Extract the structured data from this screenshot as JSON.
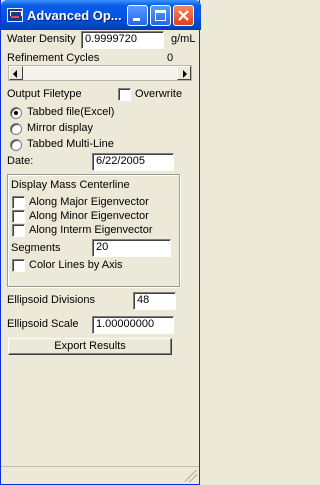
{
  "window": {
    "title": "Advanced Op...",
    "icons": {
      "app": "app-icon",
      "minimize": "minimize-icon",
      "maximize": "maximize-icon",
      "close": "close-icon"
    },
    "colors": {
      "titlebar": "#0057e5",
      "close": "#d8431a",
      "face": "#ece9d8"
    }
  },
  "water_density": {
    "label": "Water Density",
    "value": "0.9999720",
    "unit": "g/mL"
  },
  "refinement": {
    "label": "Refinement Cycles",
    "value": "0"
  },
  "output": {
    "label": "Output Filetype",
    "overwrite_label": "Overwrite",
    "overwrite_checked": false,
    "options": [
      {
        "label": "Tabbed file(Excel)",
        "selected": true
      },
      {
        "label": "Mirror display",
        "selected": false
      },
      {
        "label": "Tabbed Multi-Line",
        "selected": false
      }
    ]
  },
  "date": {
    "label": "Date:",
    "value": "6/22/2005"
  },
  "mass_centerline": {
    "title": "Display Mass Centerline",
    "options": [
      {
        "label": "Along Major Eigenvector",
        "checked": false
      },
      {
        "label": "Along Minor Eigenvector",
        "checked": false
      },
      {
        "label": "Along Interm Eigenvector",
        "checked": false
      }
    ],
    "segments_label": "Segments",
    "segments_value": "20",
    "color_lines_label": "Color Lines by Axis",
    "color_lines_checked": false
  },
  "ellipsoid": {
    "divisions_label": "Ellipsoid Divisions",
    "divisions_value": "48",
    "scale_label": "Ellipsoid Scale",
    "scale_value": "1.00000000"
  },
  "export_label": "Export Results"
}
